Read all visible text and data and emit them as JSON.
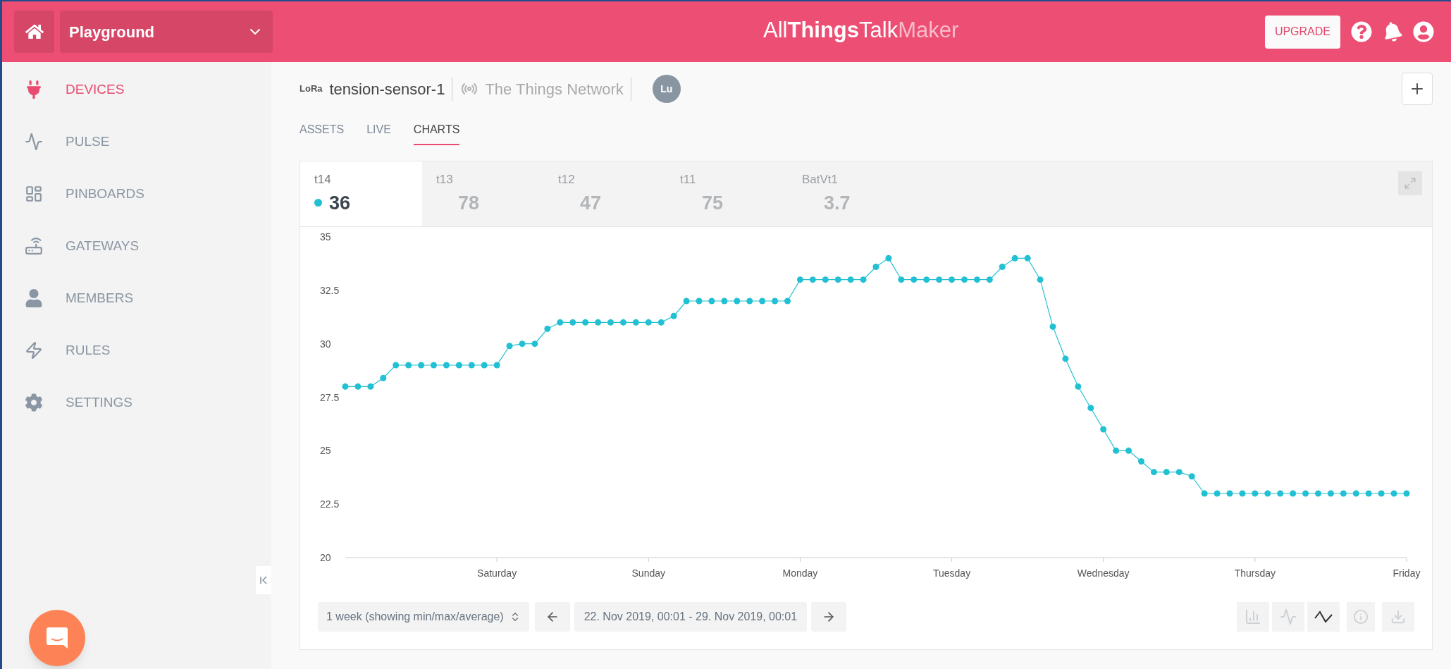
{
  "topbar": {
    "workspace": "Playground",
    "logo": {
      "text": "All**Things**Talk",
      "suffix": "Maker"
    },
    "upgrade": "UPGRADE"
  },
  "sidebar": {
    "items": [
      {
        "kind": "plug",
        "label": "DEVICES",
        "selected": true
      },
      {
        "kind": "pulse",
        "label": "PULSE",
        "selected": false
      },
      {
        "kind": "grid",
        "label": "PINBOARDS",
        "selected": false
      },
      {
        "kind": "router",
        "label": "GATEWAYS",
        "selected": false
      },
      {
        "kind": "user",
        "label": "MEMBERS",
        "selected": false
      },
      {
        "kind": "rules",
        "label": "RULES",
        "selected": false
      },
      {
        "kind": "gear",
        "label": "SETTINGS",
        "selected": false
      }
    ]
  },
  "device": {
    "badge": "LoRa",
    "name": "tension-sensor-1",
    "network": "The Things Network",
    "avatar": "Lu"
  },
  "tabs": [
    {
      "label": "ASSETS",
      "selected": false
    },
    {
      "label": "LIVE",
      "selected": false
    },
    {
      "label": "CHARTS",
      "selected": true
    }
  ],
  "metrics": [
    {
      "label": "t14",
      "value": "36",
      "selected": true
    },
    {
      "label": "t13",
      "value": "78",
      "selected": false
    },
    {
      "label": "t12",
      "value": "47",
      "selected": false
    },
    {
      "label": "t11",
      "value": "75",
      "selected": false
    },
    {
      "label": "BatVt1",
      "value": "3.7",
      "selected": false
    }
  ],
  "chart_data": {
    "type": "line",
    "ylim": [
      20,
      35
    ],
    "yticks": [
      20,
      22.5,
      25,
      27.5,
      30,
      32.5,
      35
    ],
    "categories": [
      null,
      null,
      null,
      null,
      null,
      null,
      null,
      null,
      null,
      null,
      null,
      null,
      "Saturday",
      null,
      null,
      null,
      null,
      null,
      null,
      null,
      null,
      null,
      null,
      null,
      "Sunday",
      null,
      null,
      null,
      null,
      null,
      null,
      null,
      null,
      null,
      null,
      null,
      "Monday",
      null,
      null,
      null,
      null,
      null,
      null,
      null,
      null,
      null,
      null,
      null,
      "Tuesday",
      null,
      null,
      null,
      null,
      null,
      null,
      null,
      null,
      null,
      null,
      null,
      "Wednesday",
      null,
      null,
      null,
      null,
      null,
      null,
      null,
      null,
      null,
      null,
      null,
      "Thursday",
      null,
      null,
      null,
      null,
      null,
      null,
      null,
      null,
      null,
      null,
      null,
      "Friday"
    ],
    "series": [
      {
        "color": "#22c0d3",
        "marker": "circle",
        "values": [
          28,
          28,
          28,
          28.4,
          29,
          29,
          29,
          29,
          29,
          29,
          29,
          29,
          29,
          29.9,
          30,
          30,
          30.7,
          31,
          31,
          31,
          31,
          31,
          31,
          31,
          31,
          31,
          31.3,
          32,
          32,
          32,
          32,
          32,
          32,
          32,
          32,
          32,
          33,
          33,
          33,
          33,
          33,
          33,
          33.6,
          34,
          33,
          33,
          33,
          33,
          33,
          33,
          33,
          33,
          33.6,
          34,
          34,
          33,
          30.8,
          29.3,
          28,
          27,
          26,
          25,
          25,
          24.5,
          24,
          24,
          24,
          23.8,
          23,
          23,
          23,
          23,
          23,
          23,
          23,
          23,
          23,
          23,
          23,
          23,
          23,
          23,
          23,
          23,
          23
        ]
      }
    ]
  },
  "controls": {
    "range": "1 week (showing min/max/average)",
    "period": "22. Nov 2019, 00:01 - 29. Nov 2019, 00:01"
  },
  "view_buttons": [
    {
      "kind": "bars",
      "selected": false
    },
    {
      "kind": "line",
      "selected": false
    },
    {
      "kind": "points",
      "selected": true
    }
  ]
}
